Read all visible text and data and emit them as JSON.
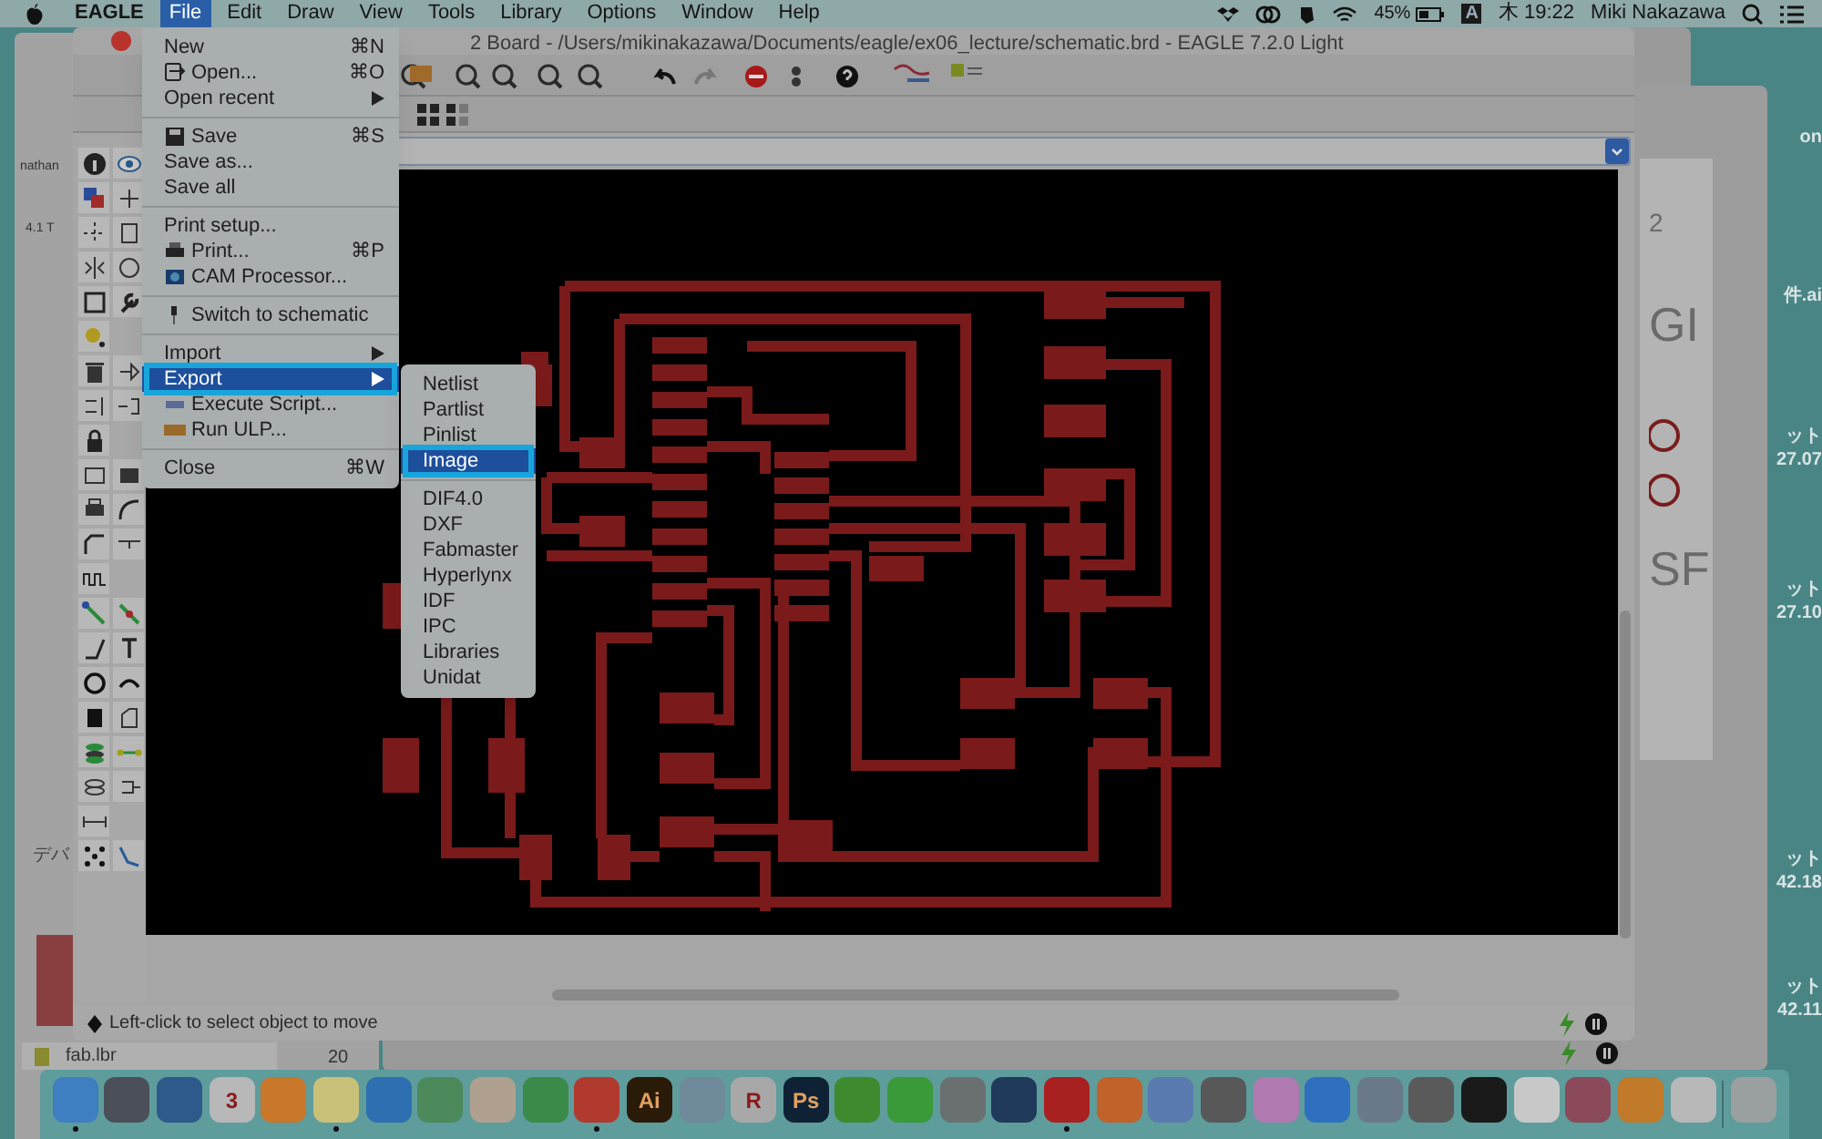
{
  "menubar": {
    "app": "EAGLE",
    "menus": [
      {
        "label": "File",
        "selected": true
      },
      {
        "label": "Edit",
        "selected": false
      },
      {
        "label": "Draw",
        "selected": false
      },
      {
        "label": "View",
        "selected": false
      },
      {
        "label": "Tools",
        "selected": false
      },
      {
        "label": "Library",
        "selected": false
      },
      {
        "label": "Options",
        "selected": false
      },
      {
        "label": "Window",
        "selected": false
      },
      {
        "label": "Help",
        "selected": false
      }
    ],
    "battery": "45%",
    "input": "A",
    "clock": "木 19:22",
    "user": "Miki Nakazawa"
  },
  "back_window": {
    "texts": [
      "nathan",
      "4.1 T",
      "デバ"
    ],
    "file": "fab.lbr",
    "zoom": "20"
  },
  "window": {
    "title": "2 Board - /Users/mikinakazawa/Documents/eagle/ex06_lecture/schematic.brd - EAGLE 7.2.0 Light",
    "status": "Left-click to select object to move"
  },
  "file_menu": [
    {
      "kind": "item",
      "label": "New",
      "shortcut": "⌘N",
      "selected": false
    },
    {
      "kind": "item",
      "label": "Open...",
      "shortcut": "⌘O",
      "selected": false
    },
    {
      "kind": "submenu",
      "label": "Open recent",
      "selected": false
    },
    {
      "kind": "separator"
    },
    {
      "kind": "item",
      "label": "Save",
      "shortcut": "⌘S",
      "selected": false
    },
    {
      "kind": "item",
      "label": "Save as...",
      "selected": false
    },
    {
      "kind": "item",
      "label": "Save all",
      "selected": false
    },
    {
      "kind": "separator"
    },
    {
      "kind": "item",
      "label": "Print setup...",
      "selected": false
    },
    {
      "kind": "item",
      "label": "Print...",
      "shortcut": "⌘P",
      "selected": false
    },
    {
      "kind": "item",
      "label": "CAM Processor...",
      "selected": false
    },
    {
      "kind": "separator"
    },
    {
      "kind": "item",
      "label": "Switch to schematic",
      "selected": false
    },
    {
      "kind": "separator"
    },
    {
      "kind": "submenu",
      "label": "Import",
      "selected": false
    },
    {
      "kind": "submenu",
      "label": "Export",
      "selected": true,
      "annotated": true
    },
    {
      "kind": "item",
      "label": "Execute Script...",
      "selected": false
    },
    {
      "kind": "item",
      "label": "Run ULP...",
      "selected": false
    },
    {
      "kind": "separator"
    },
    {
      "kind": "item",
      "label": "Close",
      "shortcut": "⌘W",
      "selected": false
    }
  ],
  "export_menu": [
    {
      "kind": "item",
      "label": "Netlist",
      "selected": false
    },
    {
      "kind": "item",
      "label": "Partlist",
      "selected": false
    },
    {
      "kind": "item",
      "label": "Pinlist",
      "selected": false
    },
    {
      "kind": "item",
      "label": "Image",
      "selected": true,
      "annotated": true
    },
    {
      "kind": "separator"
    },
    {
      "kind": "item",
      "label": "DIF4.0",
      "selected": false
    },
    {
      "kind": "item",
      "label": "DXF",
      "selected": false
    },
    {
      "kind": "item",
      "label": "Fabmaster",
      "selected": false
    },
    {
      "kind": "item",
      "label": "Hyperlynx",
      "selected": false
    },
    {
      "kind": "item",
      "label": "IDF",
      "selected": false
    },
    {
      "kind": "item",
      "label": "IPC",
      "selected": false
    },
    {
      "kind": "item",
      "label": "Libraries",
      "selected": false
    },
    {
      "kind": "item",
      "label": "Unidat",
      "selected": false
    }
  ],
  "schematic_window": {
    "labels": [
      "2",
      "GI",
      "SF"
    ]
  },
  "desktop_labels": [
    "on",
    "件.ai",
    "ット",
    "27.07",
    "ット",
    "27.10",
    "ット",
    "42.18",
    "ット",
    "42.11"
  ],
  "dock": [
    {
      "color": "#3d7fc0",
      "running": true
    },
    {
      "color": "#4a4f58",
      "running": false
    },
    {
      "color": "#2d5a8a",
      "running": false
    },
    {
      "color": "#b8b8b8",
      "label": "3",
      "running": false
    },
    {
      "color": "#c9772a",
      "running": false
    },
    {
      "color": "#c9c07a",
      "running": true
    },
    {
      "color": "#2d6fb0",
      "running": false
    },
    {
      "color": "#4c8a5c",
      "running": false
    },
    {
      "color": "#b0a090",
      "running": false
    },
    {
      "color": "#3a8a4a",
      "running": false
    },
    {
      "color": "#b03a2e",
      "running": true
    },
    {
      "color": "#2a1a08",
      "label": "Ai",
      "running": false
    },
    {
      "color": "#6f8a9a",
      "running": false
    },
    {
      "color": "#a8a8a8",
      "label": "R",
      "running": false
    },
    {
      "color": "#0f2235",
      "label": "Ps",
      "running": false
    },
    {
      "color": "#3f8a2e",
      "running": false
    },
    {
      "color": "#3a9a3a",
      "running": false
    },
    {
      "color": "#6a7070",
      "running": false
    },
    {
      "color": "#1f3a5a",
      "running": false
    },
    {
      "color": "#a82020",
      "running": true
    },
    {
      "color": "#c0622a",
      "running": false
    },
    {
      "color": "#5a7ab0",
      "running": false
    },
    {
      "color": "#585858",
      "running": false
    },
    {
      "color": "#b07ab0",
      "running": false
    },
    {
      "color": "#2f6fc0",
      "running": false
    },
    {
      "color": "#6a7a8a",
      "running": false
    },
    {
      "color": "#5a5a5a",
      "running": false
    },
    {
      "color": "#1a1a1a",
      "running": false
    },
    {
      "color": "#c8c8c8",
      "running": false
    },
    {
      "color": "#8a4a5a",
      "running": false
    },
    {
      "color": "#c07a2a",
      "running": false
    },
    {
      "color": "#b8b8b8",
      "running": false
    },
    {
      "color": "#9aa0a0",
      "running": false
    }
  ]
}
